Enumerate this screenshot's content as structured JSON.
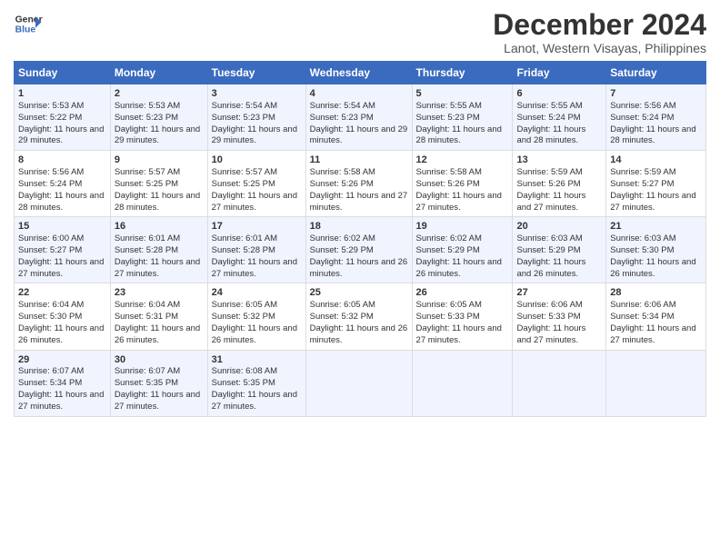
{
  "header": {
    "logo_line1": "General",
    "logo_line2": "Blue",
    "main_title": "December 2024",
    "subtitle": "Lanot, Western Visayas, Philippines"
  },
  "calendar": {
    "days_of_week": [
      "Sunday",
      "Monday",
      "Tuesday",
      "Wednesday",
      "Thursday",
      "Friday",
      "Saturday"
    ],
    "weeks": [
      [
        {
          "day": "",
          "info": ""
        },
        {
          "day": "",
          "info": ""
        },
        {
          "day": "",
          "info": ""
        },
        {
          "day": "",
          "info": ""
        },
        {
          "day": "",
          "info": ""
        },
        {
          "day": "",
          "info": ""
        },
        {
          "day": "",
          "info": ""
        }
      ]
    ],
    "cells": {
      "week1": {
        "sun": {
          "num": "1",
          "rise": "Sunrise: 5:53 AM",
          "set": "Sunset: 5:22 PM",
          "daylight": "Daylight: 11 hours and 29 minutes."
        },
        "mon": {
          "num": "2",
          "rise": "Sunrise: 5:53 AM",
          "set": "Sunset: 5:23 PM",
          "daylight": "Daylight: 11 hours and 29 minutes."
        },
        "tue": {
          "num": "3",
          "rise": "Sunrise: 5:54 AM",
          "set": "Sunset: 5:23 PM",
          "daylight": "Daylight: 11 hours and 29 minutes."
        },
        "wed": {
          "num": "4",
          "rise": "Sunrise: 5:54 AM",
          "set": "Sunset: 5:23 PM",
          "daylight": "Daylight: 11 hours and 29 minutes."
        },
        "thu": {
          "num": "5",
          "rise": "Sunrise: 5:55 AM",
          "set": "Sunset: 5:23 PM",
          "daylight": "Daylight: 11 hours and 28 minutes."
        },
        "fri": {
          "num": "6",
          "rise": "Sunrise: 5:55 AM",
          "set": "Sunset: 5:24 PM",
          "daylight": "Daylight: 11 hours and 28 minutes."
        },
        "sat": {
          "num": "7",
          "rise": "Sunrise: 5:56 AM",
          "set": "Sunset: 5:24 PM",
          "daylight": "Daylight: 11 hours and 28 minutes."
        }
      },
      "week2": {
        "sun": {
          "num": "8",
          "rise": "Sunrise: 5:56 AM",
          "set": "Sunset: 5:24 PM",
          "daylight": "Daylight: 11 hours and 28 minutes."
        },
        "mon": {
          "num": "9",
          "rise": "Sunrise: 5:57 AM",
          "set": "Sunset: 5:25 PM",
          "daylight": "Daylight: 11 hours and 28 minutes."
        },
        "tue": {
          "num": "10",
          "rise": "Sunrise: 5:57 AM",
          "set": "Sunset: 5:25 PM",
          "daylight": "Daylight: 11 hours and 27 minutes."
        },
        "wed": {
          "num": "11",
          "rise": "Sunrise: 5:58 AM",
          "set": "Sunset: 5:26 PM",
          "daylight": "Daylight: 11 hours and 27 minutes."
        },
        "thu": {
          "num": "12",
          "rise": "Sunrise: 5:58 AM",
          "set": "Sunset: 5:26 PM",
          "daylight": "Daylight: 11 hours and 27 minutes."
        },
        "fri": {
          "num": "13",
          "rise": "Sunrise: 5:59 AM",
          "set": "Sunset: 5:26 PM",
          "daylight": "Daylight: 11 hours and 27 minutes."
        },
        "sat": {
          "num": "14",
          "rise": "Sunrise: 5:59 AM",
          "set": "Sunset: 5:27 PM",
          "daylight": "Daylight: 11 hours and 27 minutes."
        }
      },
      "week3": {
        "sun": {
          "num": "15",
          "rise": "Sunrise: 6:00 AM",
          "set": "Sunset: 5:27 PM",
          "daylight": "Daylight: 11 hours and 27 minutes."
        },
        "mon": {
          "num": "16",
          "rise": "Sunrise: 6:01 AM",
          "set": "Sunset: 5:28 PM",
          "daylight": "Daylight: 11 hours and 27 minutes."
        },
        "tue": {
          "num": "17",
          "rise": "Sunrise: 6:01 AM",
          "set": "Sunset: 5:28 PM",
          "daylight": "Daylight: 11 hours and 27 minutes."
        },
        "wed": {
          "num": "18",
          "rise": "Sunrise: 6:02 AM",
          "set": "Sunset: 5:29 PM",
          "daylight": "Daylight: 11 hours and 26 minutes."
        },
        "thu": {
          "num": "19",
          "rise": "Sunrise: 6:02 AM",
          "set": "Sunset: 5:29 PM",
          "daylight": "Daylight: 11 hours and 26 minutes."
        },
        "fri": {
          "num": "20",
          "rise": "Sunrise: 6:03 AM",
          "set": "Sunset: 5:29 PM",
          "daylight": "Daylight: 11 hours and 26 minutes."
        },
        "sat": {
          "num": "21",
          "rise": "Sunrise: 6:03 AM",
          "set": "Sunset: 5:30 PM",
          "daylight": "Daylight: 11 hours and 26 minutes."
        }
      },
      "week4": {
        "sun": {
          "num": "22",
          "rise": "Sunrise: 6:04 AM",
          "set": "Sunset: 5:30 PM",
          "daylight": "Daylight: 11 hours and 26 minutes."
        },
        "mon": {
          "num": "23",
          "rise": "Sunrise: 6:04 AM",
          "set": "Sunset: 5:31 PM",
          "daylight": "Daylight: 11 hours and 26 minutes."
        },
        "tue": {
          "num": "24",
          "rise": "Sunrise: 6:05 AM",
          "set": "Sunset: 5:32 PM",
          "daylight": "Daylight: 11 hours and 26 minutes."
        },
        "wed": {
          "num": "25",
          "rise": "Sunrise: 6:05 AM",
          "set": "Sunset: 5:32 PM",
          "daylight": "Daylight: 11 hours and 26 minutes."
        },
        "thu": {
          "num": "26",
          "rise": "Sunrise: 6:05 AM",
          "set": "Sunset: 5:33 PM",
          "daylight": "Daylight: 11 hours and 27 minutes."
        },
        "fri": {
          "num": "27",
          "rise": "Sunrise: 6:06 AM",
          "set": "Sunset: 5:33 PM",
          "daylight": "Daylight: 11 hours and 27 minutes."
        },
        "sat": {
          "num": "28",
          "rise": "Sunrise: 6:06 AM",
          "set": "Sunset: 5:34 PM",
          "daylight": "Daylight: 11 hours and 27 minutes."
        }
      },
      "week5": {
        "sun": {
          "num": "29",
          "rise": "Sunrise: 6:07 AM",
          "set": "Sunset: 5:34 PM",
          "daylight": "Daylight: 11 hours and 27 minutes."
        },
        "mon": {
          "num": "30",
          "rise": "Sunrise: 6:07 AM",
          "set": "Sunset: 5:35 PM",
          "daylight": "Daylight: 11 hours and 27 minutes."
        },
        "tue": {
          "num": "31",
          "rise": "Sunrise: 6:08 AM",
          "set": "Sunset: 5:35 PM",
          "daylight": "Daylight: 11 hours and 27 minutes."
        },
        "wed": {
          "num": "",
          "rise": "",
          "set": "",
          "daylight": ""
        },
        "thu": {
          "num": "",
          "rise": "",
          "set": "",
          "daylight": ""
        },
        "fri": {
          "num": "",
          "rise": "",
          "set": "",
          "daylight": ""
        },
        "sat": {
          "num": "",
          "rise": "",
          "set": "",
          "daylight": ""
        }
      }
    }
  }
}
